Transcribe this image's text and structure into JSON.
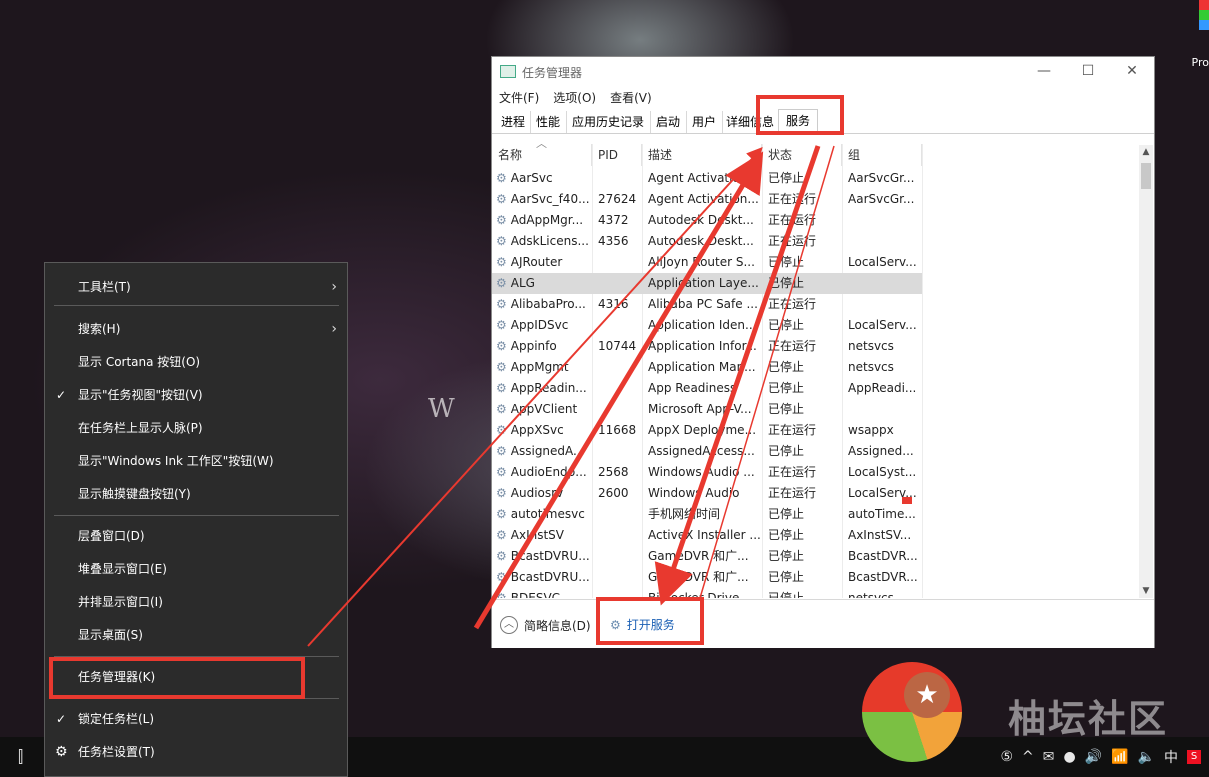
{
  "desktop": {
    "wallpaper_text": "W H",
    "corner_label": "Pro"
  },
  "context_menu": {
    "items": [
      {
        "label": "工具栏(T)",
        "submenu": true
      },
      {
        "label": "搜索(H)",
        "submenu": true
      },
      {
        "label": "显示 Cortana 按钮(O)"
      },
      {
        "label": "显示\"任务视图\"按钮(V)",
        "checked": true
      },
      {
        "label": "在任务栏上显示人脉(P)"
      },
      {
        "label": "显示\"Windows Ink 工作区\"按钮(W)"
      },
      {
        "label": "显示触摸键盘按钮(Y)"
      },
      {
        "label": "层叠窗口(D)"
      },
      {
        "label": "堆叠显示窗口(E)"
      },
      {
        "label": "并排显示窗口(I)"
      },
      {
        "label": "显示桌面(S)"
      },
      {
        "label": "任务管理器(K)"
      },
      {
        "label": "锁定任务栏(L)",
        "checked": true
      },
      {
        "label": "任务栏设置(T)",
        "icon": "gear-icon"
      }
    ],
    "check_glyph": "✓",
    "chevron_glyph": "›"
  },
  "task_manager": {
    "title": "任务管理器",
    "menu": [
      "文件(F)",
      "选项(O)",
      "查看(V)"
    ],
    "tabs": [
      "进程",
      "性能",
      "应用历史记录",
      "启动",
      "用户",
      "详细信息",
      "服务"
    ],
    "active_tab": "服务",
    "columns": [
      "名称",
      "PID",
      "描述",
      "状态",
      "组"
    ],
    "rows": [
      [
        "AarSvc",
        "",
        "Agent Activation...",
        "已停止",
        "AarSvcGr..."
      ],
      [
        "AarSvc_f40...",
        "27624",
        "Agent Activation...",
        "正在运行",
        "AarSvcGr..."
      ],
      [
        "AdAppMgr...",
        "4372",
        "Autodesk Deskt...",
        "正在运行",
        ""
      ],
      [
        "AdskLicens...",
        "4356",
        "Autodesk Deskt...",
        "正在运行",
        ""
      ],
      [
        "AJRouter",
        "",
        "AllJoyn Router S...",
        "已停止",
        "LocalServ..."
      ],
      [
        "ALG",
        "",
        "Application Laye...",
        "已停止",
        ""
      ],
      [
        "AlibabaPro...",
        "4316",
        "Alibaba PC Safe ...",
        "正在运行",
        ""
      ],
      [
        "AppIDSvc",
        "",
        "Application Iden...",
        "已停止",
        "LocalServ..."
      ],
      [
        "Appinfo",
        "10744",
        "Application Infor...",
        "正在运行",
        "netsvcs"
      ],
      [
        "AppMgmt",
        "",
        "Application Man...",
        "已停止",
        "netsvcs"
      ],
      [
        "AppReadin...",
        "",
        "App Readiness",
        "已停止",
        "AppReadi..."
      ],
      [
        "AppVClient",
        "",
        "Microsoft App-V...",
        "已停止",
        ""
      ],
      [
        "AppXSvc",
        "11668",
        "AppX Deployme...",
        "正在运行",
        "wsappx"
      ],
      [
        "AssignedA...",
        "",
        "AssignedAccess...",
        "已停止",
        "Assigned..."
      ],
      [
        "AudioEndp...",
        "2568",
        "Windows Audio ...",
        "正在运行",
        "LocalSyst..."
      ],
      [
        "Audiosrv",
        "2600",
        "Windows Audio",
        "正在运行",
        "LocalServ..."
      ],
      [
        "autotimesvc",
        "",
        "手机网络时间",
        "已停止",
        "autoTime..."
      ],
      [
        "AxInstSV",
        "",
        "ActiveX Installer ...",
        "已停止",
        "AxInstSV..."
      ],
      [
        "BcastDVRU...",
        "",
        "GameDVR 和广...",
        "已停止",
        "BcastDVR..."
      ],
      [
        "BcastDVRU...",
        "",
        "GameDVR 和广...",
        "已停止",
        "BcastDVR..."
      ],
      [
        "BDESVC",
        "",
        "BitLocker Drive ...",
        "已停止",
        "netsvcs"
      ]
    ],
    "selected_row": "ALG",
    "footer": {
      "fewer_details": "简略信息(D)",
      "open_services": "打开服务"
    },
    "window_buttons": [
      "—",
      "☐",
      "✕"
    ]
  },
  "taskbar": {
    "tray": [
      "⑤",
      "^",
      "✉",
      "●",
      "🔊",
      "📶",
      "🔈",
      "中",
      "S"
    ]
  },
  "watermark": {
    "text": "柚坛社区"
  },
  "highlight_color": "#e8392f"
}
